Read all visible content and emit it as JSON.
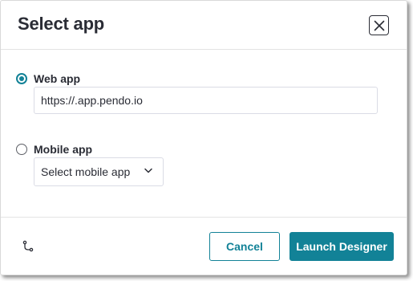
{
  "dialog": {
    "title": "Select app",
    "close_icon": "close-icon"
  },
  "options": {
    "web": {
      "label": "Web app",
      "selected": true,
      "url_value": "https://.app.pendo.io"
    },
    "mobile": {
      "label": "Mobile app",
      "selected": false,
      "select_value": "Select mobile app",
      "select_icon": "chevron-down-icon"
    }
  },
  "footer": {
    "branch_icon": "branch-icon",
    "cancel_label": "Cancel",
    "launch_label": "Launch Designer"
  },
  "colors": {
    "accent": "#128297",
    "text": "#2a2c35",
    "border": "#dadce5"
  }
}
